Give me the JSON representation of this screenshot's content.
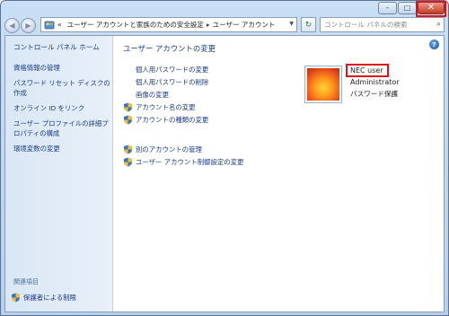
{
  "window": {
    "caption": {
      "minimize": "–",
      "maximize": "□",
      "close": "✕"
    }
  },
  "address_bar": {
    "prefix": "«",
    "segments": [
      "ユーザー アカウントと家族のための安全設定",
      "ユーザー アカウント"
    ],
    "separator": "▸"
  },
  "search": {
    "placeholder": "コントロール パネルの検索"
  },
  "sidebar": {
    "home": "コントロール パネル ホーム",
    "links": [
      "資格情報の管理",
      "パスワード リセット ディスクの作成",
      "オンライン ID をリンク",
      "ユーザー プロファイルの詳細プロパティの構成",
      "環境変数の変更"
    ],
    "related_heading": "関連項目",
    "parental": "保護者による制限"
  },
  "main": {
    "title": "ユーザー アカウントの変更",
    "tasks": [
      {
        "label": "個人用パスワードの変更",
        "shield": false
      },
      {
        "label": "個人用パスワードの削除",
        "shield": false
      },
      {
        "label": "画像の変更",
        "shield": false
      },
      {
        "label": "アカウント名の変更",
        "shield": true
      },
      {
        "label": "アカウントの種類の変更",
        "shield": true
      }
    ],
    "tasks2": [
      {
        "label": "別のアカウントの管理",
        "shield": true
      },
      {
        "label": "ユーザー アカウント制御設定の変更",
        "shield": true
      }
    ]
  },
  "account": {
    "name": "NEC user",
    "type": "Administrator",
    "protection": "パスワード保護"
  },
  "colors": {
    "link": "#1b3b86",
    "highlight": "#e0121b"
  }
}
